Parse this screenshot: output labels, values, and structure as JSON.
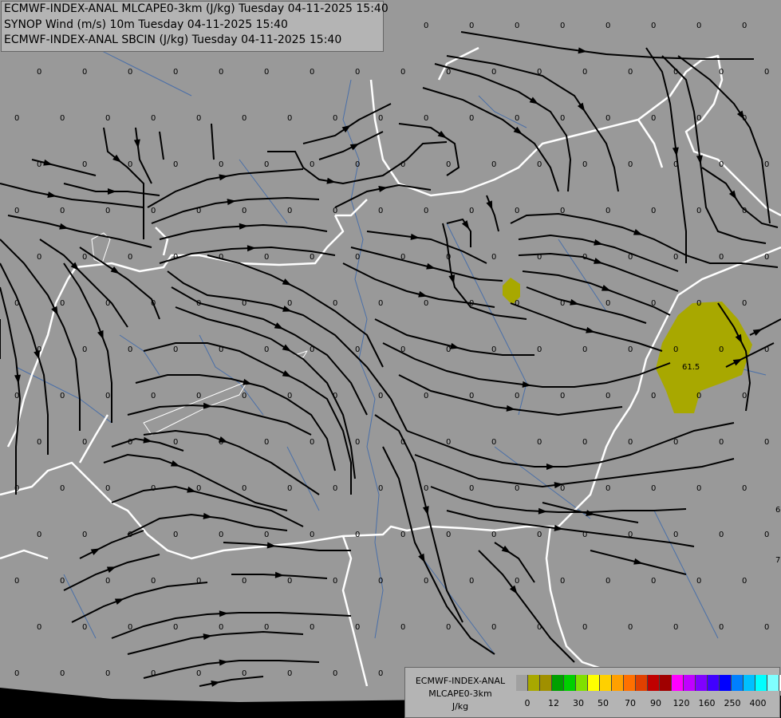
{
  "titles": [
    "ECMWF-INDEX-ANAL MLCAPE0-3km (J/kg) Tuesday 04-11-2025 15:40",
    "SYNOP Wind (m/s) 10m Tuesday 04-11-2025 15:40",
    "ECMWF-INDEX-ANAL SBCIN (J/kg) Tuesday 04-11-2025 15:40"
  ],
  "legend": {
    "model": "ECMWF-INDEX-ANAL",
    "parameter": "MLCAPE0-3km",
    "unit": "J/kg",
    "colors": [
      "#a0a0a0",
      "#a8a800",
      "#a09000",
      "#00a000",
      "#00d000",
      "#80e000",
      "#ffff00",
      "#ffd000",
      "#ffa000",
      "#ff7000",
      "#e04000",
      "#c00000",
      "#a00000",
      "#ff00ff",
      "#c000ff",
      "#8000ff",
      "#4000ff",
      "#0000ff",
      "#0080ff",
      "#00c0ff",
      "#00ffff",
      "#80ffff",
      "#ffffff"
    ],
    "tick_labels": [
      "0",
      "12",
      "30",
      "50",
      "70",
      "90",
      "120",
      "160",
      "250",
      "400"
    ]
  },
  "map": {
    "background_color": "#999999",
    "cape_fill_color": "#a8a800",
    "border_color": "#ffffff",
    "river_color": "#4a6fa8",
    "streamline_color": "#000000",
    "cape_label": "61.5",
    "grid_value": "0",
    "edge_values": [
      "6",
      "7"
    ]
  }
}
